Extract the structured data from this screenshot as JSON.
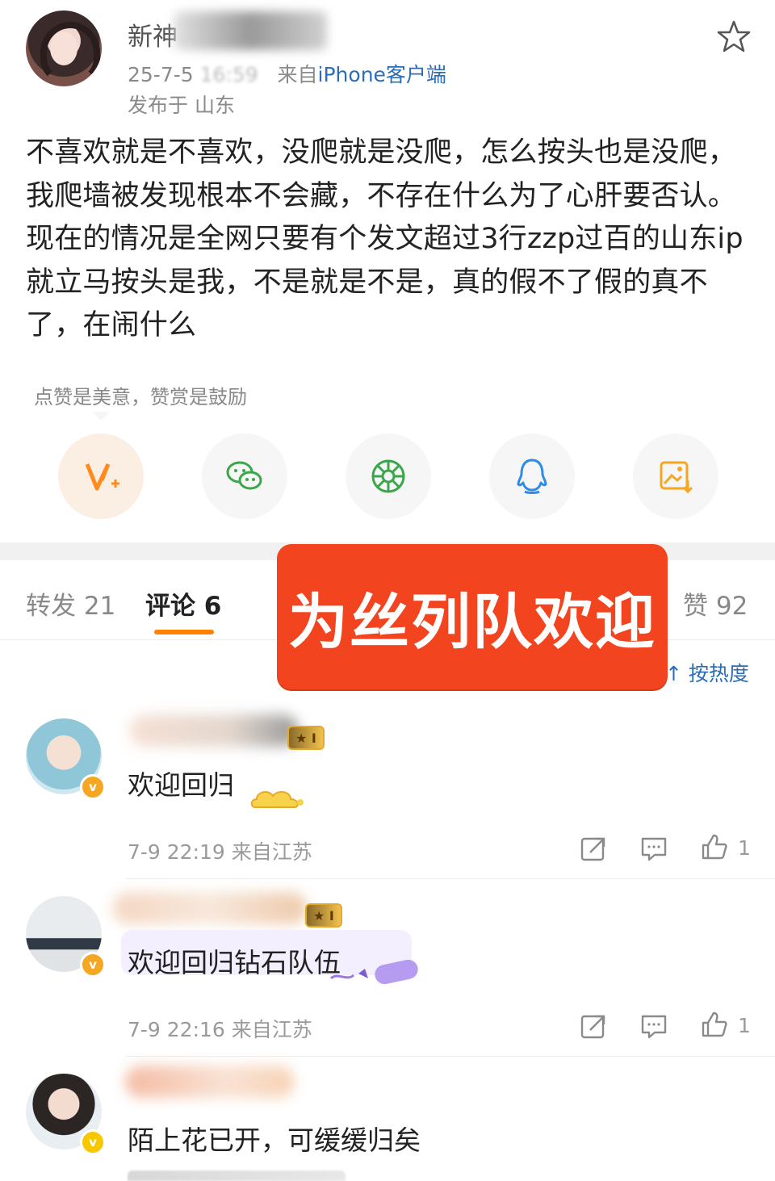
{
  "post": {
    "username": "新神",
    "time": "25-7-5",
    "time_blurred": "16:59",
    "source_prefix": "来自",
    "source": "iPhone客户端",
    "location": "发布于 山东",
    "text": "不喜欢就是不喜欢，没爬就是没爬，怎么按头也是没爬，我爬墙被发现根本不会藏，不存在什么为了心肝要否认。现在的情况是全网只要有个发文超过3行zzp过百的山东ip就立马按头是我，不是就是不是，真的假不了假的真不了，在闹什么"
  },
  "reward": {
    "hint": "点赞是美意，赞赏是鼓励",
    "buttons": [
      "v-plus-icon",
      "wechat-icon",
      "moments-icon",
      "qq-icon",
      "save-image-icon"
    ]
  },
  "tabs": {
    "repost": "转发 21",
    "comments": "评论 6",
    "likes": "赞 92",
    "sort": "按热度"
  },
  "banner": {
    "text": "为丝列队欢迎"
  },
  "comments": [
    {
      "text": "欢迎回归",
      "meta": "7-9 22:19  来自江苏",
      "likes": "1"
    },
    {
      "text": "欢迎回归钻石队伍",
      "meta": "7-9 22:16  来自江苏",
      "likes": "1"
    },
    {
      "text": "陌上花已开，可缓缓归矣",
      "meta": "",
      "likes": ""
    }
  ],
  "colors": {
    "accent": "#ff8200",
    "link": "#2c6db5",
    "banner": "#f2441f"
  }
}
